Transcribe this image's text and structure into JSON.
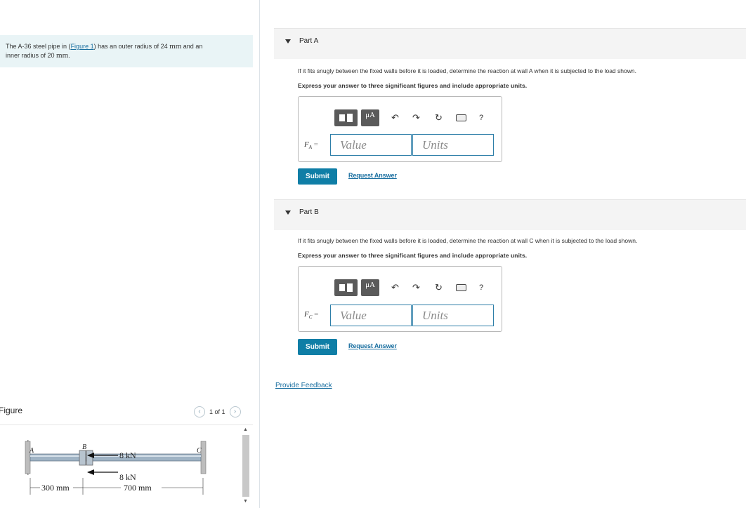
{
  "problem": {
    "text_1": "The A-36 steel pipe in (",
    "figure_link": "Figure 1",
    "text_2": ") has an outer radius of 24 ",
    "unit_1": "mm",
    "text_3": " and an",
    "text_4": "inner radius of 20 ",
    "unit_2": "mm",
    "text_5": "."
  },
  "figure": {
    "title": "Figure",
    "pager": "1 of 1",
    "prev_icon": "chevron-left-icon",
    "next_icon": "chevron-right-icon",
    "labels": {
      "point_a": "A",
      "point_b": "B",
      "point_c": "C",
      "load_1": "8 kN",
      "load_2": "8 kN",
      "dim_1": "300 mm",
      "dim_2": "700 mm"
    }
  },
  "parts": [
    {
      "title": "Part A",
      "question": "If it fits snugly between the fixed walls before it is loaded, determine the reaction at wall A when it is subjected to the load shown.",
      "instructions": "Express your answer to three significant figures and include appropriate units.",
      "var_label": "F",
      "var_sub": "A",
      "eq": "=",
      "value_placeholder": "Value",
      "units_placeholder": "Units",
      "submit": "Submit",
      "request": "Request Answer"
    },
    {
      "title": "Part B",
      "question": "If it fits snugly between the fixed walls before it is loaded, determine the reaction at wall C when it is subjected to the load shown.",
      "instructions": "Express your answer to three significant figures and include appropriate units.",
      "var_label": "F",
      "var_sub": "C",
      "eq": "=",
      "value_placeholder": "Value",
      "units_placeholder": "Units",
      "submit": "Submit",
      "request": "Request Answer"
    }
  ],
  "toolbar": {
    "mu_label": "μA",
    "help_label": "?",
    "icons": [
      "templates-icon",
      "units-icon",
      "undo-icon",
      "redo-icon",
      "reset-icon",
      "keyboard-icon",
      "help-icon"
    ]
  },
  "feedback": "Provide Feedback",
  "colors": {
    "accent": "#0f7ea6",
    "link": "#1a6fa0",
    "problem_bg": "#e9f4f6"
  }
}
